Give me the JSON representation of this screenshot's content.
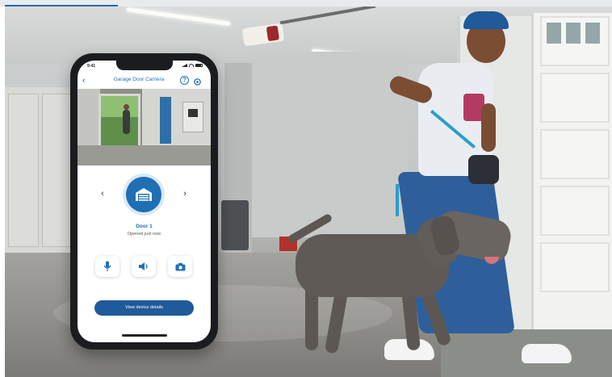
{
  "phone": {
    "status_bar": {
      "time": "9:41"
    },
    "header": {
      "title": "Garage Door Camera"
    },
    "door": {
      "name": "Door 1",
      "status": "Opened just now"
    },
    "devices_button": "View device details",
    "icons": [
      "back-icon",
      "help-icon",
      "gear-icon",
      "chevron-left-icon",
      "garage-door-icon",
      "chevron-right-icon",
      "microphone-icon",
      "speaker-icon",
      "camera-icon"
    ]
  },
  "colors": {
    "accent": "#1f6fb5",
    "button_dark": "#1f5a9a"
  }
}
